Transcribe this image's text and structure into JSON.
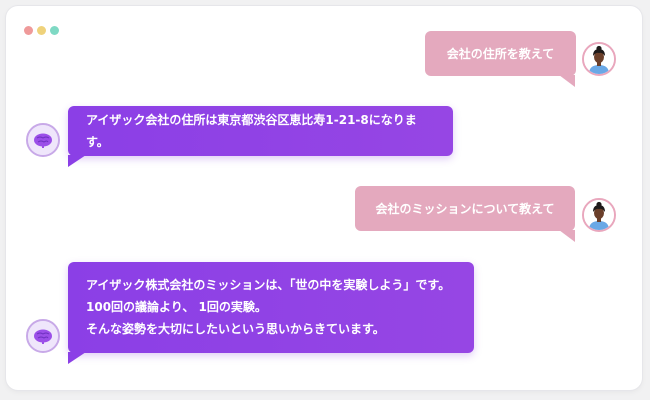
{
  "window_controls": {
    "colors": [
      "#ef9a9a",
      "#efd27b",
      "#7fd9c4"
    ]
  },
  "messages": [
    {
      "role": "user",
      "text": "会社の住所を教えて"
    },
    {
      "role": "bot",
      "lines": [
        "アイザック会社の住所は東京都渋谷区恵比寿1-21-8になります。"
      ]
    },
    {
      "role": "user",
      "text": "会社のミッションについて教えて"
    },
    {
      "role": "bot",
      "lines": [
        "アイザック株式会社のミッションは、「世の中を実験しよう」です。",
        "100回の議論より、 1回の実験。",
        "そんな姿勢を大切にしたいという思いからきています。"
      ]
    }
  ],
  "colors": {
    "user_bubble": "#e4a9be",
    "bot_bubble": "#8b3fe6"
  }
}
